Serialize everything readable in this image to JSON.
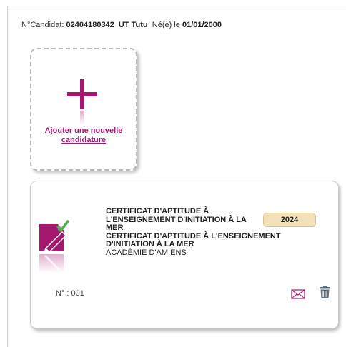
{
  "candidate": {
    "label_prefix": "N°Candidat:",
    "number": "02404180342",
    "name": "UT  Tutu",
    "born_label": "Né(e) le",
    "birth_date": "01/01/2000"
  },
  "add_card": {
    "link_text": "Ajouter une nouvelle candidature",
    "icon": "plus-icon",
    "accent": "#a5186f"
  },
  "candidature": {
    "title_line": "CERTIFICAT D'APTITUDE À L'ENSEIGNEMENT D'INITIATION À LA MER",
    "subtitle_line": "CERTIFICAT D'APTITUDE À L'ENSEIGNEMENT D'INITIATION À LA MER",
    "academy": "ACADÉMIE D'AMIENS",
    "year": "2024",
    "number": "N° : 001",
    "icons": {
      "certificate": "certificate-edit-icon",
      "mail": "envelope-icon",
      "delete": "trash-icon"
    },
    "colors": {
      "icon": "#a5186f",
      "check": "#4caf50",
      "badge_bg": "#f3e1b9",
      "trash": "#5a7080"
    }
  }
}
